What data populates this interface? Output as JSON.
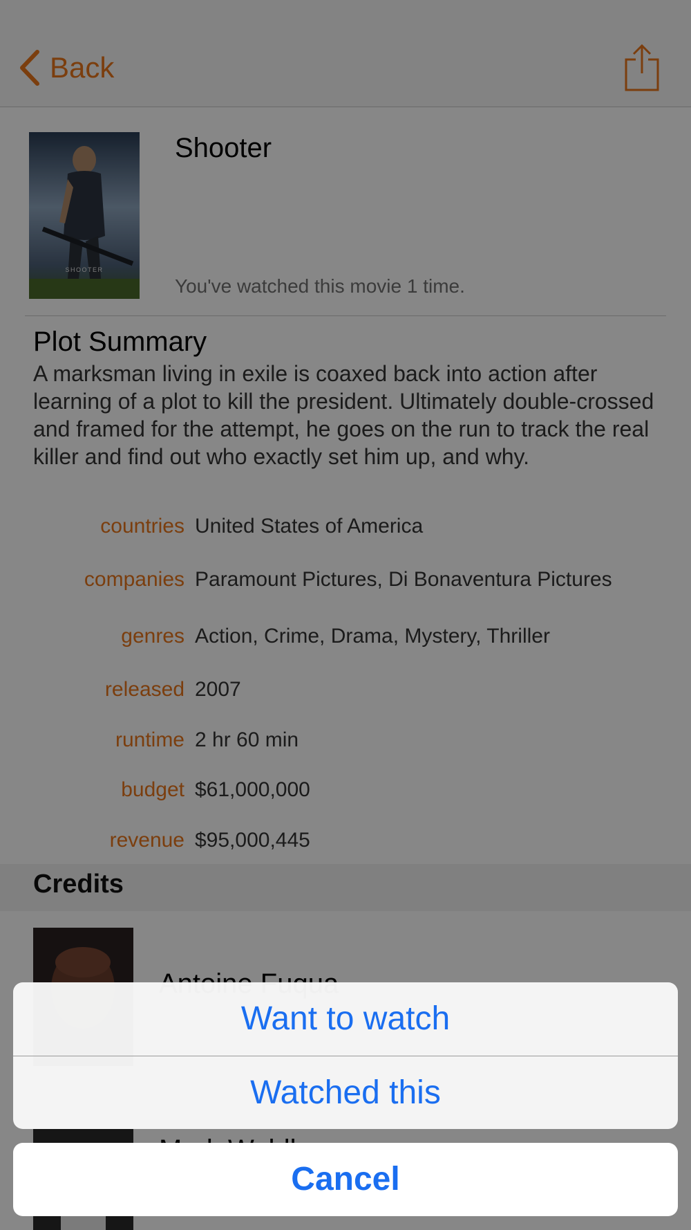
{
  "nav": {
    "back_label": "Back"
  },
  "movie": {
    "title": "Shooter",
    "poster_caption": "SHOOTER",
    "watched_text": "You've watched this movie 1 time."
  },
  "plot": {
    "heading": "Plot Summary",
    "text": "A marksman living in exile is coaxed back into action after learning of a plot to kill the president. Ultimately double-crossed and framed for the attempt, he goes on the run to track the real killer and find out who exactly set him up, and why."
  },
  "details": [
    {
      "label": "countries",
      "value": "United States of America"
    },
    {
      "label": "companies",
      "value": "Paramount Pictures, Di Bonaventura Pictures"
    },
    {
      "label": "genres",
      "value": "Action, Crime, Drama, Mystery, Thriller"
    },
    {
      "label": "released",
      "value": "2007"
    },
    {
      "label": "runtime",
      "value": "2 hr 60 min"
    },
    {
      "label": "budget",
      "value": "$61,000,000"
    },
    {
      "label": "revenue",
      "value": "$95,000,445"
    }
  ],
  "credits": {
    "heading": "Credits",
    "people": [
      {
        "name": "Antoine Fuqua"
      },
      {
        "name": "Mark Wahlberg"
      }
    ]
  },
  "action_sheet": {
    "want_label": "Want to watch",
    "watched_label": "Watched this",
    "cancel_label": "Cancel"
  },
  "colors": {
    "accent": "#e8761c",
    "action": "#1a6ef0"
  }
}
